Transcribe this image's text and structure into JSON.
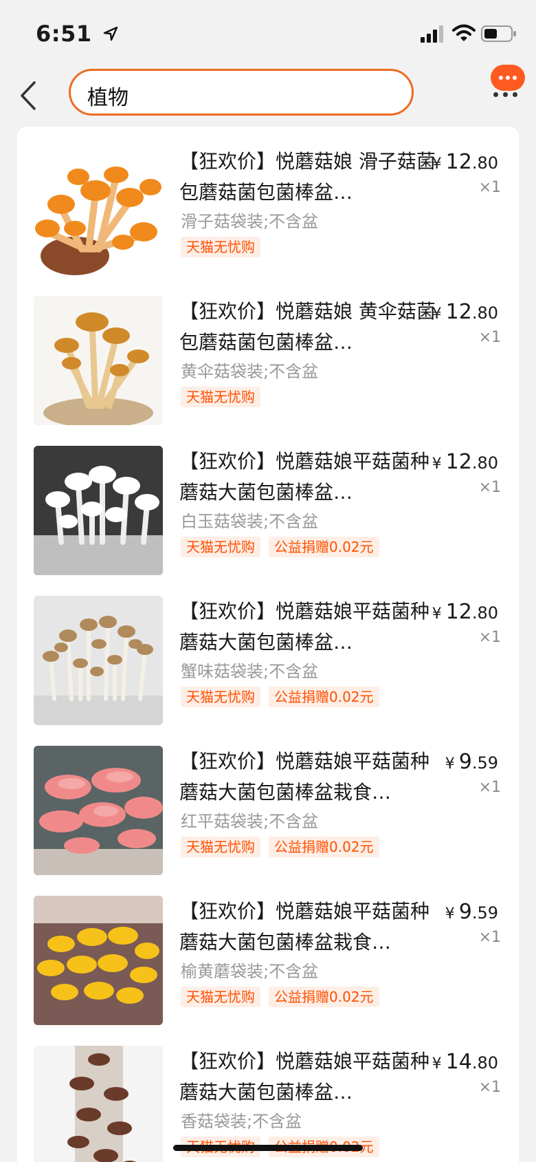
{
  "status_bar": {
    "time": "6:51"
  },
  "search": {
    "query": "植物"
  },
  "items": [
    {
      "title": "【狂欢价】悦蘑菇娘 滑子菇菌包蘑菇菌包菌棒盆…",
      "spec": "滑子菇袋装;不含盆",
      "tags": [
        "天猫无忧购"
      ],
      "price_int": "12",
      "price_dec": ".80",
      "qty": "×1",
      "image": "orange-mushroom-cluster"
    },
    {
      "title": "【狂欢价】悦蘑菇娘 黄伞菇菌包蘑菇菌包菌棒盆…",
      "spec": "黄伞菇袋装;不含盆",
      "tags": [
        "天猫无忧购"
      ],
      "price_int": "12",
      "price_dec": ".80",
      "qty": "×1",
      "image": "golden-umbrella-mushroom"
    },
    {
      "title": "【狂欢价】悦蘑菇娘平菇菌种蘑菇大菌包菌棒盆…",
      "spec": "白玉菇袋装;不含盆",
      "tags": [
        "天猫无忧购",
        "公益捐赠0.02元"
      ],
      "price_int": "12",
      "price_dec": ".80",
      "qty": "×1",
      "image": "white-jade-mushroom"
    },
    {
      "title": "【狂欢价】悦蘑菇娘平菇菌种蘑菇大菌包菌棒盆…",
      "spec": "蟹味菇袋装;不含盆",
      "tags": [
        "天猫无忧购",
        "公益捐赠0.02元"
      ],
      "price_int": "12",
      "price_dec": ".80",
      "qty": "×1",
      "image": "crab-flavor-mushroom"
    },
    {
      "title": "【狂欢价】悦蘑菇娘平菇菌种蘑菇大菌包菌棒盆栽食…",
      "spec": "红平菇袋装;不含盆",
      "tags": [
        "天猫无忧购",
        "公益捐赠0.02元"
      ],
      "price_int": "9",
      "price_dec": ".59",
      "qty": "×1",
      "image": "pink-oyster-mushroom"
    },
    {
      "title": "【狂欢价】悦蘑菇娘平菇菌种蘑菇大菌包菌棒盆栽食…",
      "spec": "榆黄蘑袋装;不含盆",
      "tags": [
        "天猫无忧购",
        "公益捐赠0.02元"
      ],
      "price_int": "9",
      "price_dec": ".59",
      "qty": "×1",
      "image": "yellow-oyster-mushroom"
    },
    {
      "title": "【狂欢价】悦蘑菇娘平菇菌种蘑菇大菌包菌棒盆…",
      "spec": "香菇袋装;不含盆",
      "tags": [
        "天猫无忧购",
        "公益捐赠0.02元"
      ],
      "price_int": "14",
      "price_dec": ".80",
      "qty": "×1",
      "image": "shiitake-mushroom"
    }
  ],
  "price_symbol": "¥",
  "colors": {
    "accent": "#ff5000",
    "search_border": "#ee6a22",
    "more_bubble": "#ff5a1f"
  }
}
